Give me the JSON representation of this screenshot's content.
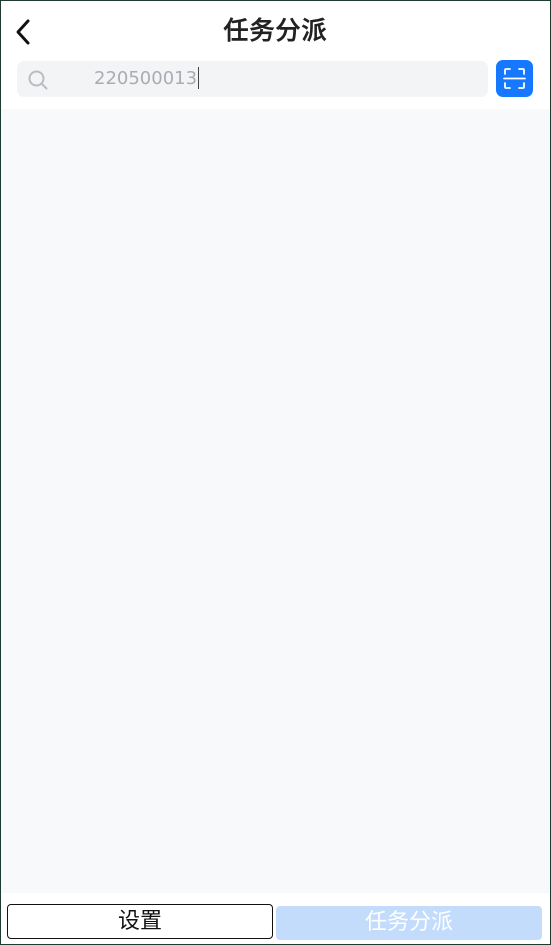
{
  "header": {
    "title": "任务分派",
    "back_icon": "chevron-left-icon"
  },
  "search": {
    "icon": "search-icon",
    "value": "220500013",
    "scan_icon": "scan-icon"
  },
  "footer": {
    "settings_label": "设置",
    "dispatch_label": "任务分派"
  },
  "colors": {
    "accent": "#1677ff",
    "accent_disabled": "#c3dcfc",
    "content_bg": "#f7f9fa",
    "search_bg": "#f3f4f6"
  }
}
